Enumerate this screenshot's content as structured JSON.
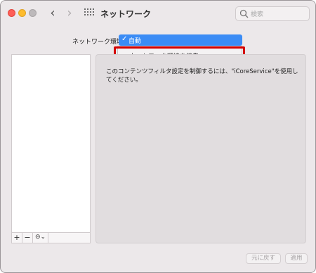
{
  "window": {
    "title": "ネットワーク"
  },
  "search": {
    "placeholder": "検索"
  },
  "location": {
    "label": "ネットワーク環境：",
    "selected_value": "自動",
    "menu_item": "ネットワーク環境を編集..."
  },
  "service_list": {
    "toolbar": {
      "add": "+",
      "remove": "−",
      "action": "⊝⌄"
    }
  },
  "detail": {
    "message": "このコンテンツフィルタ設定を制御するには、\"iCoreService\"を使用してください。"
  },
  "buttons": {
    "revert": "元に戻す",
    "apply": "適用"
  },
  "colors": {
    "accent": "#3b8cf5",
    "highlight": "#d40000",
    "close": "#fe5f57",
    "minimize": "#febc2e",
    "zoom": "#bdb9bb"
  }
}
